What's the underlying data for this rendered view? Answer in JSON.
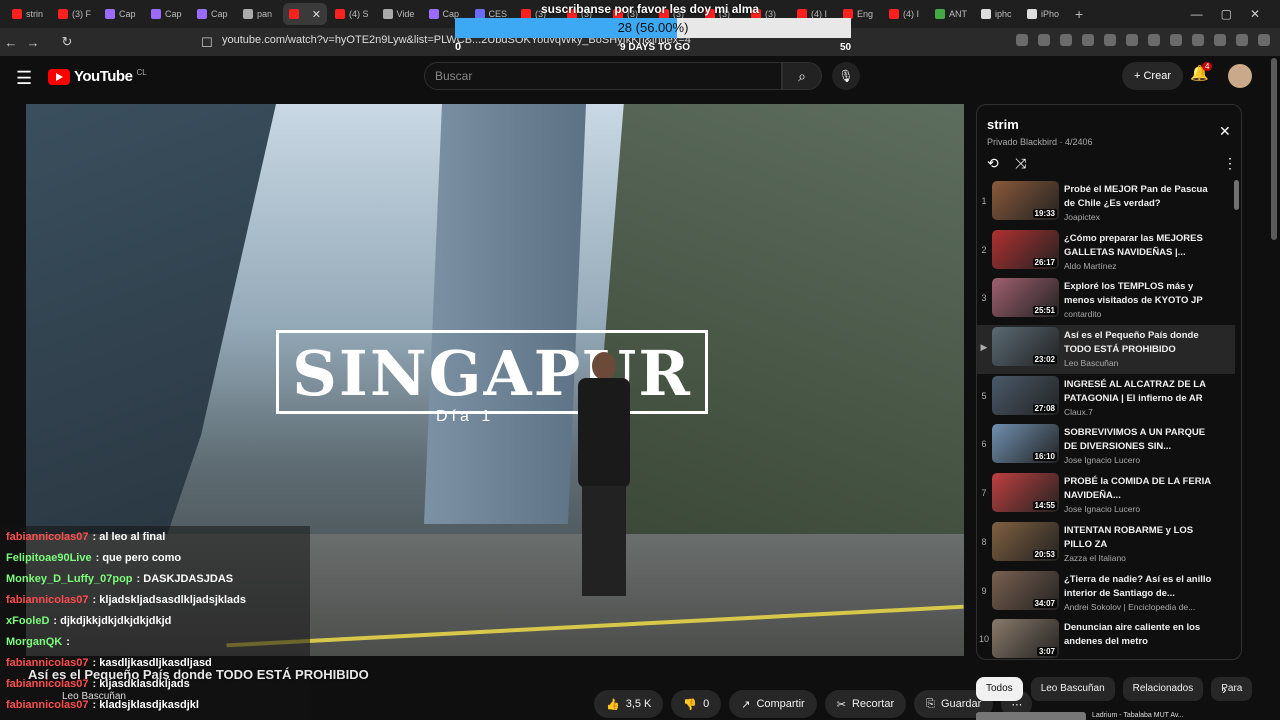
{
  "browser": {
    "tabs": [
      {
        "label": "strin",
        "color": "#ff2020"
      },
      {
        "label": "(3) F",
        "color": "#ff2020"
      },
      {
        "label": "Cap",
        "color": "#9b6bff"
      },
      {
        "label": "Cap",
        "color": "#9b6bff"
      },
      {
        "label": "Cap",
        "color": "#9b6bff"
      },
      {
        "label": "pan",
        "color": "#aaaaaa"
      },
      {
        "label": "",
        "color": "#ff2020",
        "active": true
      },
      {
        "label": "(4) S",
        "color": "#ff2020"
      },
      {
        "label": "Vide",
        "color": "#aaaaaa"
      },
      {
        "label": "Cap",
        "color": "#9b6bff"
      },
      {
        "label": "CES",
        "color": "#6b6bff"
      },
      {
        "label": "(3)",
        "color": "#ff2020"
      },
      {
        "label": "(3)",
        "color": "#ff2020"
      },
      {
        "label": "(3)",
        "color": "#ff2020"
      },
      {
        "label": "(3)",
        "color": "#ff2020"
      },
      {
        "label": "(3)",
        "color": "#ff2020"
      },
      {
        "label": "(3)",
        "color": "#ff2020"
      },
      {
        "label": "(4) I",
        "color": "#ff2020"
      },
      {
        "label": "Eng",
        "color": "#ff2020"
      },
      {
        "label": "(4) I",
        "color": "#ff2020"
      },
      {
        "label": "ANT",
        "color": "#44aa44"
      },
      {
        "label": "iphc",
        "color": "#dddddd"
      },
      {
        "label": "iPho",
        "color": "#dddddd"
      }
    ],
    "url": "youtube.com/watch?v=hyOTE2n9Lyw&list=PLWCB...2UbdSOKYouvqWky_BoSHyIkKh&index=4"
  },
  "stream_overlay": {
    "title": "suscribanse por favor les doy mi alma",
    "goal_text": "28 (56.00%)",
    "goal_progress": 56,
    "goal_min": "0",
    "goal_max": "50",
    "goal_days": "9 DAYS TO GO"
  },
  "header": {
    "logo_text": "YouTube",
    "country": "CL",
    "search_placeholder": "Buscar",
    "create_label": "Crear",
    "notifications": "4"
  },
  "video": {
    "title_overlay": "SINGAPUR",
    "subtitle_overlay": "Día 1",
    "caption": "Así es el Pequeño País donde TODO ESTÁ PROHIBIDO",
    "channel": "Leo Bascuñan",
    "actions": {
      "likes": "3,5 K",
      "dislikes": "0",
      "share": "Compartir",
      "clip": "Recortar",
      "save": "Guardar"
    }
  },
  "chat": [
    {
      "user": "fabiannicolas07",
      "text": ": al leo al final",
      "color": "#ff4d4d"
    },
    {
      "user": "Felipitoae90Live",
      "text": ": que pero como",
      "color": "#7cfc7c"
    },
    {
      "user": "Monkey_D_Luffy_07pop",
      "text": ": DASKJDASJDAS",
      "color": "#7cfc7c"
    },
    {
      "user": "fabiannicolas07",
      "text": ": kljadskljadsasdlkljadsjklads",
      "color": "#ff4d4d"
    },
    {
      "user": "xFooleD",
      "text": ": djkdjkkjdkjdkjdkjdkjd",
      "color": "#7cfc7c"
    },
    {
      "user": "MorganQK",
      "text": ":",
      "color": "#7cfc7c"
    },
    {
      "user": "fabiannicolas07",
      "text": ": kasdljkasdljkasdljasd",
      "color": "#ff4d4d"
    },
    {
      "user": "fabiannicolas07",
      "text": ": kljasdklasdkljads",
      "color": "#ff4d4d"
    },
    {
      "user": "fabiannicolas07",
      "text": ": kladsjklasdjkasdjkl",
      "color": "#ff4d4d"
    }
  ],
  "playlist": {
    "title": "strim",
    "meta": "Privado Blackbird · 4/2406",
    "items": [
      {
        "index": "1",
        "title": "Probé el MEJOR Pan de Pascua de Chile ¿Es verdad?",
        "channel": "Joapictex",
        "duration": "19:33",
        "color": "#8a5a3a"
      },
      {
        "index": "2",
        "title": "¿Cómo preparar las MEJORES GALLETAS NAVIDEÑAS |...",
        "channel": "Aldo Martínez",
        "duration": "26:17",
        "color": "#b03030"
      },
      {
        "index": "3",
        "title": "Exploré los TEMPLOS más y menos visitados de KYOTO JP",
        "channel": "contardito",
        "duration": "25:51",
        "color": "#a06070"
      },
      {
        "index": "",
        "title": "Así es el Pequeño País donde TODO ESTÁ PROHIBIDO",
        "channel": "Leo Bascuñan",
        "duration": "23:02",
        "color": "#5a6a74",
        "current": true
      },
      {
        "index": "5",
        "title": "INGRESÉ AL ALCATRAZ DE LA PATAGONIA | El infierno de AR",
        "channel": "Claux.7",
        "duration": "27:08",
        "color": "#4a5a6a"
      },
      {
        "index": "6",
        "title": "SOBREVIVIMOS A UN PARQUE DE DIVERSIONES SIN...",
        "channel": "Jose Ignacio Lucero",
        "duration": "16:10",
        "color": "#7090b0"
      },
      {
        "index": "7",
        "title": "PROBÉ la COMIDA DE LA FERIA NAVIDEÑA...",
        "channel": "Jose Ignacio Lucero",
        "duration": "14:55",
        "color": "#c04040"
      },
      {
        "index": "8",
        "title": "INTENTAN ROBARME y LOS PILLO ZA",
        "channel": "Zazza el Italiano",
        "duration": "20:53",
        "color": "#806040"
      },
      {
        "index": "9",
        "title": "¿Tierra de nadie? Así es el anillo interior de Santiago de...",
        "channel": "Andrei Sokolov | Enciclopedia de...",
        "duration": "34:07",
        "color": "#7a6050"
      },
      {
        "index": "10",
        "title": "Denuncian aire caliente en los andenes del metro",
        "channel": "",
        "duration": "3:07",
        "color": "#8a7a6a"
      }
    ]
  },
  "chips": [
    "Todos",
    "Leo Bascuñan",
    "Relacionados",
    "Para"
  ],
  "next_item": {
    "title": "Ladrium - Tabalaba MUT Av..."
  }
}
